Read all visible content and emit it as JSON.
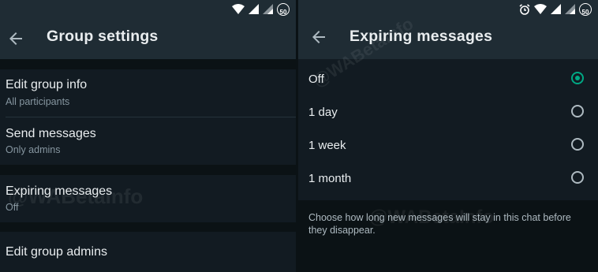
{
  "left": {
    "title": "Group settings",
    "rows": [
      {
        "primary": "Edit group info",
        "secondary": "All participants"
      },
      {
        "primary": "Send messages",
        "secondary": "Only admins"
      },
      {
        "primary": "Expiring messages",
        "secondary": "Off"
      },
      {
        "primary": "Edit group admins"
      }
    ]
  },
  "right": {
    "title": "Expiring messages",
    "options": [
      {
        "label": "Off",
        "selected": true
      },
      {
        "label": "1 day",
        "selected": false
      },
      {
        "label": "1 week",
        "selected": false
      },
      {
        "label": "1 month",
        "selected": false
      }
    ],
    "footnote": "Choose how long new messages will stay in this chat before they disappear."
  },
  "status": {
    "battery_level": "50"
  },
  "watermark": "@WABetaInfo",
  "icons": {
    "back": "back-arrow-icon",
    "wifi": "wifi-icon",
    "signal": "signal-icon",
    "alarm": "alarm-icon",
    "battery": "battery-icon"
  },
  "colors": {
    "accent": "#00a884",
    "toolbar": "#1f2c34",
    "background": "#121b22",
    "separator": "#0b1215",
    "secondary_text": "#8696a0"
  }
}
